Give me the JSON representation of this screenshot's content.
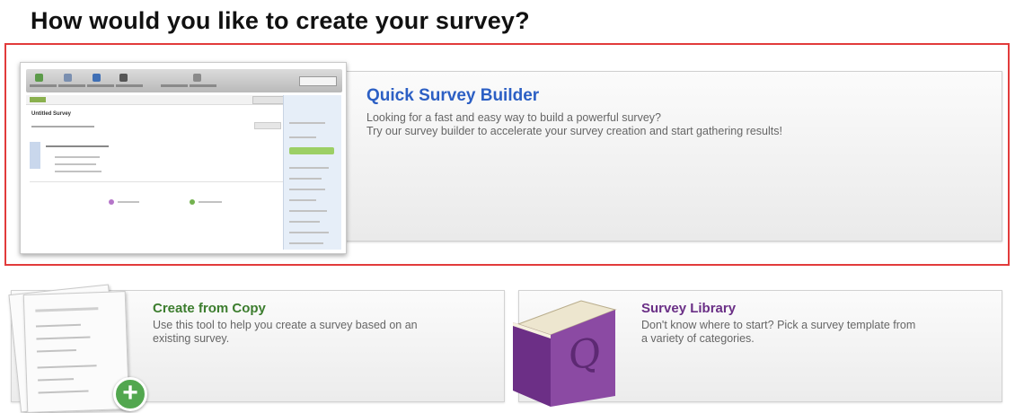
{
  "page_title": "How would you like to create your survey?",
  "options": {
    "quick": {
      "title": "Quick Survey Builder",
      "description_line1": "Looking for a fast and easy way to build a powerful survey?",
      "description_line2": "Try our survey builder to accelerate your survey creation and start gathering results!",
      "selected": true,
      "icon": "survey-builder-screenshot"
    },
    "copy": {
      "title": "Create from Copy",
      "description_line1": "Use this tool to help you create a survey based on an",
      "description_line2": "existing survey.",
      "icon": "copy-documents-plus"
    },
    "library": {
      "title": "Survey Library",
      "description_line1": "Don't know where to start? Pick a survey template from",
      "description_line2": "a variety of categories.",
      "icon": "purple-book-q",
      "book_letter": "Q"
    }
  },
  "colors": {
    "selection_border": "#e23b3b",
    "quick_title": "#2c5fc4",
    "copy_title": "#3c7d2e",
    "library_title": "#6a2f86",
    "book": "#8b4aa3",
    "plus": "#52a74f"
  },
  "thumbnail": {
    "survey_title": "Untitled Survey"
  }
}
